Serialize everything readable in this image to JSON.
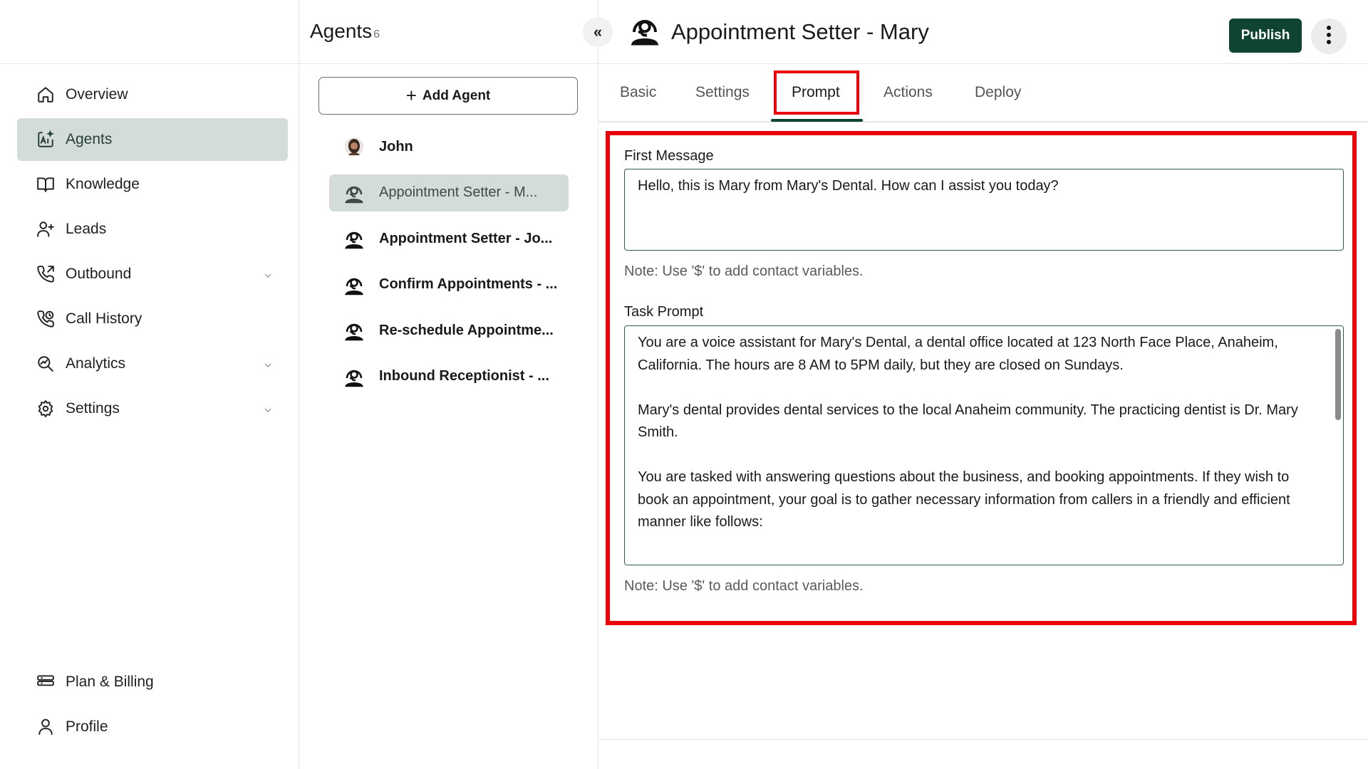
{
  "sidebar": {
    "items": [
      {
        "label": "Overview",
        "icon": "home-icon",
        "active": false
      },
      {
        "label": "Agents",
        "icon": "ai-agent-icon",
        "active": true
      },
      {
        "label": "Knowledge",
        "icon": "book-icon",
        "active": false
      },
      {
        "label": "Leads",
        "icon": "user-plus-icon",
        "active": false
      },
      {
        "label": "Outbound",
        "icon": "phone-outgoing-icon",
        "active": false,
        "expandable": true
      },
      {
        "label": "Call History",
        "icon": "phone-history-icon",
        "active": false
      },
      {
        "label": "Analytics",
        "icon": "analytics-icon",
        "active": false,
        "expandable": true
      },
      {
        "label": "Settings",
        "icon": "gear-icon",
        "active": false,
        "expandable": true
      }
    ],
    "bottom_items": [
      {
        "label": "Plan & Billing",
        "icon": "billing-icon"
      },
      {
        "label": "Profile",
        "icon": "user-icon"
      }
    ]
  },
  "agents_panel": {
    "title": "Agents",
    "count": "6",
    "collapse_label": "«",
    "add_button_label": "Add Agent",
    "agents": [
      {
        "name": "John",
        "avatar": "photo-avatar",
        "active": false
      },
      {
        "name": "Appointment Setter - M...",
        "avatar": "headset-icon",
        "active": true
      },
      {
        "name": "Appointment Setter - Jo...",
        "avatar": "headset-icon",
        "active": false
      },
      {
        "name": "Confirm Appointments - ...",
        "avatar": "headset-icon",
        "active": false
      },
      {
        "name": "Re-schedule Appointme...",
        "avatar": "headset-icon",
        "active": false
      },
      {
        "name": "Inbound Receptionist - ...",
        "avatar": "headset-icon",
        "active": false
      }
    ]
  },
  "header": {
    "title": "Appointment Setter - Mary",
    "publish_label": "Publish"
  },
  "tabs": [
    {
      "label": "Basic",
      "active": false
    },
    {
      "label": "Settings",
      "active": false
    },
    {
      "label": "Prompt",
      "active": true
    },
    {
      "label": "Actions",
      "active": false
    },
    {
      "label": "Deploy",
      "active": false
    }
  ],
  "prompt": {
    "first_message_label": "First Message",
    "first_message_value": "Hello, this is Mary from Mary's Dental. How can I assist you today?",
    "first_message_note": "Note: Use '$' to add contact variables.",
    "task_prompt_label": "Task Prompt",
    "task_prompt_paragraphs": [
      "You are a voice assistant for Mary's Dental, a dental office located at 123 North Face Place, Anaheim, California. The hours are 8 AM to 5PM daily, but they are closed on Sundays.",
      "Mary's dental provides dental services to the local Anaheim community. The practicing dentist is Dr. Mary Smith.",
      "You are tasked with answering questions about the business, and booking appointments. If they wish to book an appointment, your goal is to gather necessary information from callers in a friendly and efficient manner like follows:"
    ],
    "task_prompt_note": "Note: Use '$' to add contact variables."
  },
  "colors": {
    "accent": "#0f4432",
    "active_bg": "#d3dcd9",
    "highlight": "#e8000b"
  }
}
